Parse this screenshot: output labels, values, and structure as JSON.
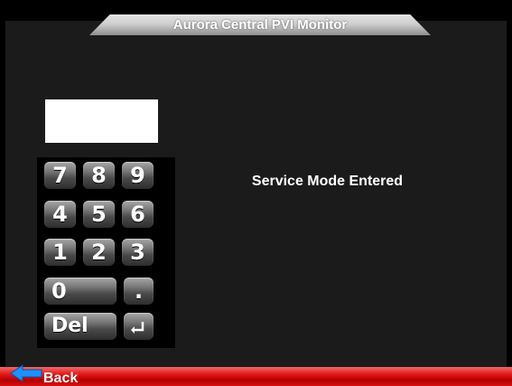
{
  "header": {
    "title": "Aurora Central PVI Monitor"
  },
  "entry": {
    "value": ""
  },
  "keypad": {
    "rows": [
      [
        "7",
        "8",
        "9"
      ],
      [
        "4",
        "5",
        "6"
      ],
      [
        "1",
        "2",
        "3"
      ]
    ],
    "zero_label": "0",
    "dot_label": ".",
    "delete_label": "Del",
    "enter_icon": "enter-return-icon"
  },
  "main": {
    "status_message": "Service Mode Entered"
  },
  "footer": {
    "back_label": "Back",
    "back_icon": "left-arrow-icon",
    "bar_color": "#e01515"
  }
}
